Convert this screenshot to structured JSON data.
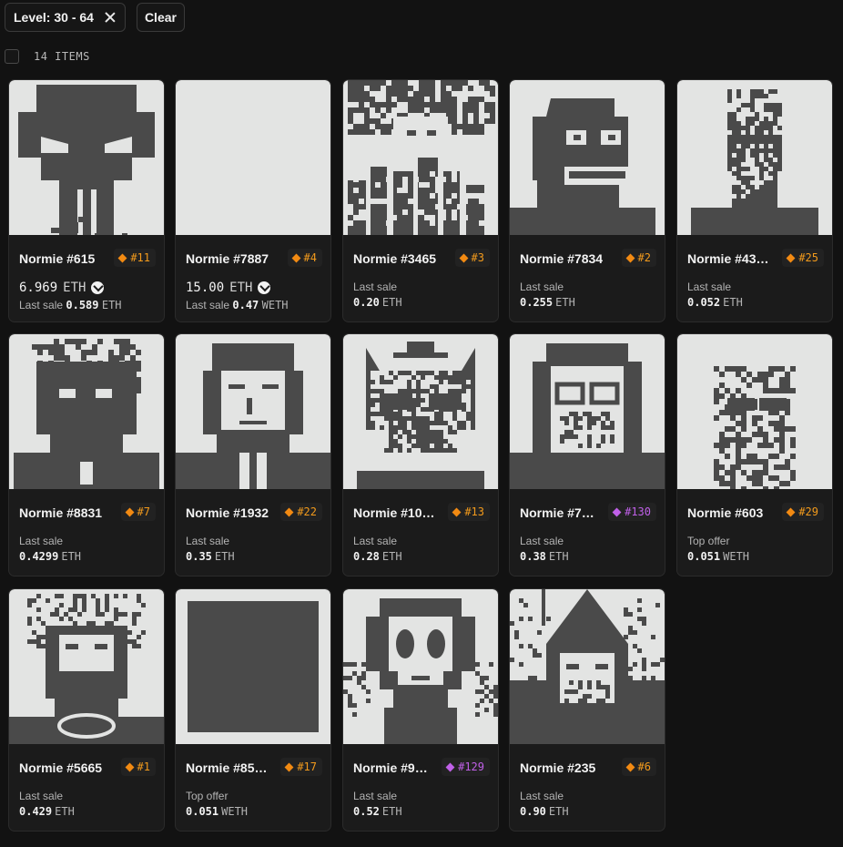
{
  "filter": {
    "label": "Level: 30 - 64",
    "clear_label": "Clear"
  },
  "results": {
    "count_label": "14 ITEMS"
  },
  "colors": {
    "accent_orange": "#f28a12",
    "accent_purple": "#c060e8",
    "art_bg": "#e3e4e3",
    "art_fg": "#4a4a4a"
  },
  "cards": [
    {
      "name": "Normie #615",
      "rank": "#11",
      "rank_color": "orange",
      "list_price": "6.969",
      "list_unit": "ETH",
      "sub_label": "Last sale",
      "sub_value": "0.589",
      "sub_unit": "ETH",
      "icon": "buy-now-icon",
      "art": "punisher-skull"
    },
    {
      "name": "Normie #7887",
      "rank": "#4",
      "rank_color": "orange",
      "list_price": "15.00",
      "list_unit": "ETH",
      "sub_label": "Last sale",
      "sub_value": "0.47",
      "sub_unit": "WETH",
      "icon": "buy-now-icon",
      "art": "blank"
    },
    {
      "name": "Normie #3465",
      "rank": "#3",
      "rank_color": "orange",
      "label": "Last sale",
      "value": "0.20",
      "unit": "ETH",
      "art": "city-hair"
    },
    {
      "name": "Normie #7834",
      "rank": "#2",
      "rank_color": "orange",
      "label": "Last sale",
      "value": "0.255",
      "unit": "ETH",
      "art": "pepe-mask"
    },
    {
      "name": "Normie #43…",
      "rank": "#25",
      "rank_color": "orange",
      "label": "Last sale",
      "value": "0.052",
      "unit": "ETH",
      "art": "bearded-goggles"
    },
    {
      "name": "Normie #8831",
      "rank": "#7",
      "rank_color": "orange",
      "label": "Last sale",
      "value": "0.4299",
      "unit": "ETH",
      "art": "lion"
    },
    {
      "name": "Normie #1932",
      "rank": "#22",
      "rank_color": "orange",
      "label": "Last sale",
      "value": "0.35",
      "unit": "ETH",
      "art": "suit-man"
    },
    {
      "name": "Normie #10…",
      "rank": "#13",
      "rank_color": "orange",
      "label": "Last sale",
      "value": "0.28",
      "unit": "ETH",
      "art": "cat-sunglasses"
    },
    {
      "name": "Normie #7…",
      "rank": "#130",
      "rank_color": "purple",
      "label": "Last sale",
      "value": "0.38",
      "unit": "ETH",
      "art": "hood-glasses"
    },
    {
      "name": "Normie #603",
      "rank": "#29",
      "rank_color": "orange",
      "label": "Top offer",
      "value": "0.051",
      "unit": "WETH",
      "art": "noisy-face"
    },
    {
      "name": "Normie #5665",
      "rank": "#1",
      "rank_color": "orange",
      "label": "Last sale",
      "value": "0.429",
      "unit": "ETH",
      "art": "crown-of-thorns"
    },
    {
      "name": "Normie #85…",
      "rank": "#17",
      "rank_color": "orange",
      "label": "Top offer",
      "value": "0.051",
      "unit": "WETH",
      "art": "dark-square"
    },
    {
      "name": "Normie #9…",
      "rank": "#129",
      "rank_color": "purple",
      "label": "Last sale",
      "value": "0.52",
      "unit": "ETH",
      "art": "alien"
    },
    {
      "name": "Normie #235",
      "rank": "#6",
      "rank_color": "orange",
      "label": "Last sale",
      "value": "0.90",
      "unit": "ETH",
      "art": "tall-hat"
    }
  ]
}
